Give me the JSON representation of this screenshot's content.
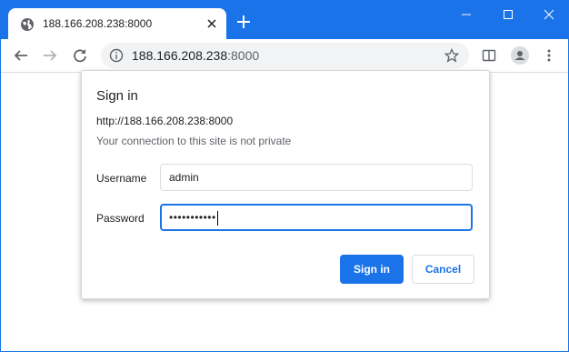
{
  "browser": {
    "tab_title": "188.166.208.238:8000",
    "url_host": "188.166.208.238",
    "url_port": ":8000",
    "accent_color": "#1a73e8"
  },
  "dialog": {
    "title": "Sign in",
    "origin": "http://188.166.208.238:8000",
    "warning": "Your connection to this site is not private",
    "username_label": "Username",
    "username_value": "admin",
    "password_label": "Password",
    "password_masked": "•••••••••••",
    "sign_in_label": "Sign in",
    "cancel_label": "Cancel"
  },
  "icons": [
    "globe-icon",
    "tab-close-icon",
    "new-tab-icon",
    "minimize-icon",
    "maximize-icon",
    "window-close-icon",
    "back-icon",
    "forward-icon",
    "reload-icon",
    "info-icon",
    "star-icon",
    "reading-list-icon",
    "profile-icon",
    "menu-icon"
  ]
}
